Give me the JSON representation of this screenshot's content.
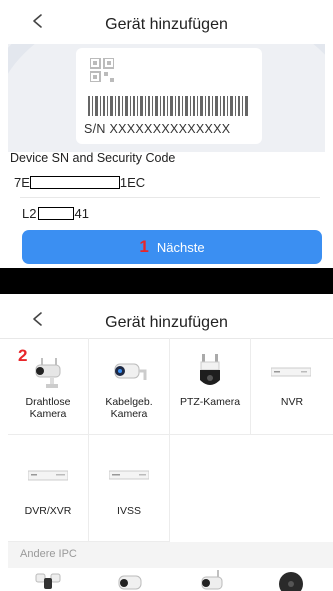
{
  "screen1": {
    "title": "Gerät hinzufügen",
    "label_sn": "S/N  XXXXXXXXXXXXXX",
    "section_label": "Device SN and Security Code",
    "sn_prefix": "7E",
    "sn_suffix": "1EC",
    "code_prefix": "L2",
    "code_suffix": "41",
    "next_button": "Nächste",
    "step_marker": "1"
  },
  "screen2": {
    "title": "Gerät hinzufügen",
    "step_marker": "2",
    "devices": [
      {
        "label": "Drahtlose Kamera",
        "icon": "wireless-camera-icon"
      },
      {
        "label": "Kabelgeb. Kamera",
        "icon": "wired-camera-icon"
      },
      {
        "label": "PTZ-Kamera",
        "icon": "ptz-camera-icon"
      },
      {
        "label": "NVR",
        "icon": "nvr-icon"
      },
      {
        "label": "DVR/XVR",
        "icon": "dvr-xvr-icon"
      },
      {
        "label": "IVSS",
        "icon": "ivss-icon"
      }
    ],
    "section": "Andere IPC",
    "other_icons": [
      "floodlight-camera-icon",
      "bullet-camera-icon",
      "outdoor-wifi-camera-icon",
      "dome-camera-icon"
    ]
  },
  "colors": {
    "accent": "#3b8ff2",
    "step_marker": "#e8262a",
    "section_bg": "#f4f4f4"
  }
}
